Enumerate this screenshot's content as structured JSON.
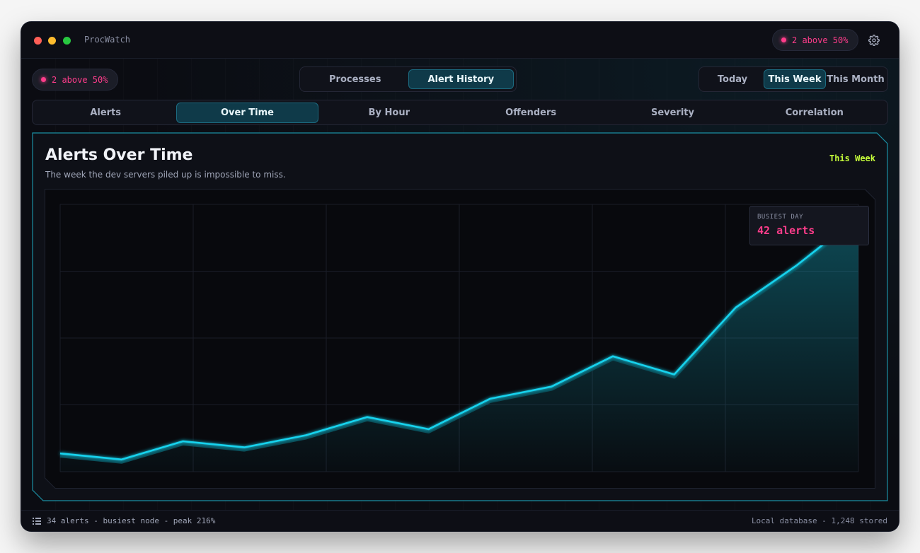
{
  "window": {
    "app_name": "ProcWatch"
  },
  "alert_badge": {
    "label": "2 above 50%"
  },
  "main_tabs": [
    {
      "label": "Processes",
      "active": false
    },
    {
      "label": "Alert History",
      "active": true
    }
  ],
  "range_tabs": [
    {
      "label": "Today",
      "active": false
    },
    {
      "label": "This Week",
      "active": true
    },
    {
      "label": "This Month",
      "active": false
    }
  ],
  "sub_tabs": [
    {
      "label": "Alerts",
      "active": false
    },
    {
      "label": "Over Time",
      "active": true
    },
    {
      "label": "By Hour",
      "active": false
    },
    {
      "label": "Offenders",
      "active": false
    },
    {
      "label": "Severity",
      "active": false
    },
    {
      "label": "Correlation",
      "active": false
    }
  ],
  "panel": {
    "title": "Alerts Over Time",
    "subtitle": "The week the dev servers piled up is impossible to miss.",
    "range_label": "This Week"
  },
  "tooltip": {
    "label": "BUSIEST DAY",
    "value": "42 alerts"
  },
  "chart_data": {
    "type": "area",
    "title": "Alerts Over Time",
    "xlabel": "",
    "ylabel": "",
    "x": [
      0,
      1,
      2,
      3,
      4,
      5,
      6,
      7,
      8,
      9,
      10,
      11,
      12,
      13
    ],
    "series": [
      {
        "values": [
          3,
          2,
          5,
          4,
          6,
          9,
          7,
          12,
          14,
          19,
          16,
          27,
          34,
          42
        ]
      }
    ],
    "ylim": [
      0,
      44
    ],
    "grid": true,
    "legend": "none",
    "colors": {
      "line": "#19d3ee",
      "peak": "#ff3d8b"
    }
  },
  "statusbar": {
    "left": "34 alerts - busiest node - peak 216%",
    "right": "Local database - 1,248 stored"
  },
  "colors": {
    "accent": "#19d3ee",
    "alert": "#ff3d8b",
    "highlight": "#c6ff3a",
    "background": "#0b0c12"
  },
  "icons": {
    "gear": "gear-icon",
    "list": "list-icon"
  }
}
